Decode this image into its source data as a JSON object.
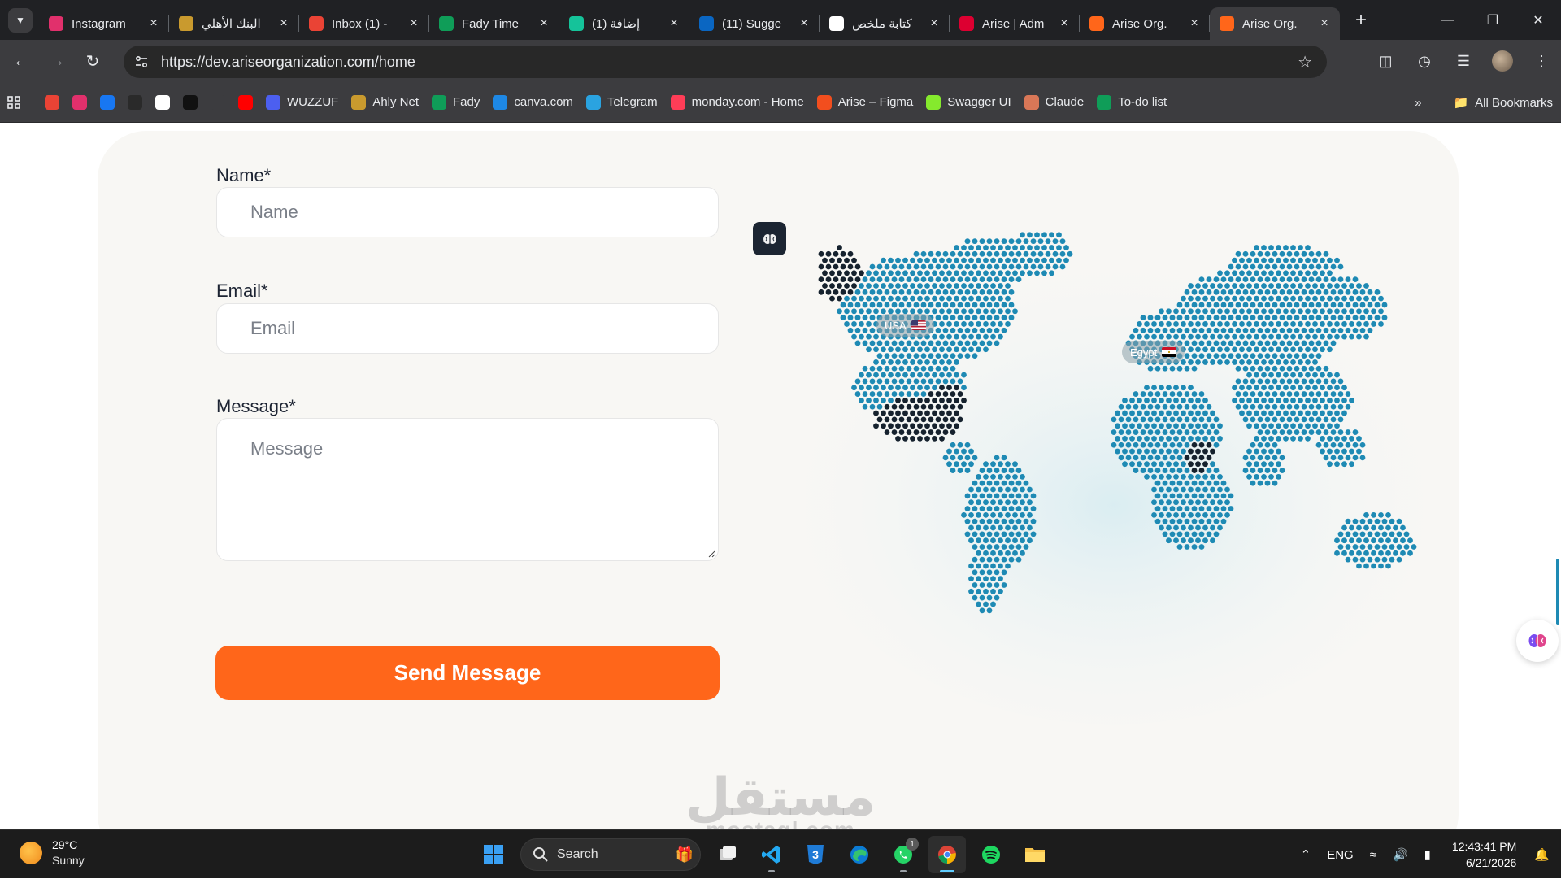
{
  "browser": {
    "tabs": [
      {
        "title": "Instagram",
        "favicon": "instagram-icon",
        "color": "#e1306c"
      },
      {
        "title": "البنك الأهلي",
        "favicon": "ahly-bank-icon",
        "color": "#c99a2e"
      },
      {
        "title": "Inbox (1) -",
        "favicon": "gmail-icon",
        "color": "#ea4335"
      },
      {
        "title": "Fady Time",
        "favicon": "sheets-icon",
        "color": "#0f9d58"
      },
      {
        "title": "(1) إضافة",
        "favicon": "grammarly-icon",
        "color": "#15c39a"
      },
      {
        "title": "(11) Sugge",
        "favicon": "linkedin-icon",
        "color": "#0a66c2"
      },
      {
        "title": "كتابة ملخص",
        "favicon": "chatgpt-icon",
        "color": "#ffffff"
      },
      {
        "title": "Arise | Adm",
        "favicon": "angular-icon",
        "color": "#dd0031"
      },
      {
        "title": "Arise Org.",
        "favicon": "arise-icon",
        "color": "#ff661a"
      },
      {
        "title": "Arise Org.",
        "favicon": "arise-icon",
        "color": "#ff661a"
      }
    ],
    "active_tab_index": 9,
    "url": "https://dev.ariseorganization.com/home",
    "bookmarks": [
      {
        "label": "",
        "icon": "gmail-icon",
        "color": "#ea4335"
      },
      {
        "label": "",
        "icon": "instagram-icon",
        "color": "#e1306c"
      },
      {
        "label": "",
        "icon": "facebook-icon",
        "color": "#1877f2"
      },
      {
        "label": "",
        "icon": "dark-app-icon",
        "color": "#2a2a2a"
      },
      {
        "label": "",
        "icon": "chatgpt-icon",
        "color": "#ffffff"
      },
      {
        "label": "",
        "icon": "365-icon",
        "color": "#111111"
      },
      {
        "label": "",
        "icon": "speedtest-icon",
        "color": "#3c3c3f"
      },
      {
        "label": "",
        "icon": "youtube-icon",
        "color": "#ff0000"
      },
      {
        "label": "WUZZUF",
        "icon": "wuzzuf-icon",
        "color": "#4c5ff0"
      },
      {
        "label": "Ahly Net",
        "icon": "ahly-bank-icon",
        "color": "#c99a2e"
      },
      {
        "label": "Fady",
        "icon": "sheets-icon",
        "color": "#0f9d58"
      },
      {
        "label": "canva.com",
        "icon": "canva-icon",
        "color": "#1e88e5"
      },
      {
        "label": "Telegram",
        "icon": "telegram-icon",
        "color": "#2aa3e0"
      },
      {
        "label": "monday.com - Home",
        "icon": "monday-icon",
        "color": "#ff3d57"
      },
      {
        "label": "Arise – Figma",
        "icon": "figma-icon",
        "color": "#f24e1e"
      },
      {
        "label": "Swagger UI",
        "icon": "swagger-icon",
        "color": "#85ea2d"
      },
      {
        "label": "Claude",
        "icon": "claude-icon",
        "color": "#d97757"
      },
      {
        "label": "To-do list",
        "icon": "sheets-icon",
        "color": "#0f9d58"
      }
    ],
    "all_bookmarks_label": "All Bookmarks"
  },
  "form": {
    "name_label": "Name*",
    "name_placeholder": "Name",
    "email_label": "Email*",
    "email_placeholder": "Email",
    "message_label": "Message*",
    "message_placeholder": "Message",
    "submit_label": "Send Message"
  },
  "map": {
    "pins": [
      {
        "label": "USA",
        "flag": "usa-flag-icon"
      },
      {
        "label": "Egypt",
        "flag": "egypt-flag-icon"
      }
    ],
    "dot_color": "#1e8ab4",
    "highlight_color": "#16222e"
  },
  "watermark": {
    "arabic": "مستقل",
    "latin": "mostaql.com"
  },
  "taskbar": {
    "weather_temp": "29°C",
    "weather_desc": "Sunny",
    "search_label": "Search",
    "whatsapp_badge": "1",
    "language": "ENG",
    "time": "12:43:41 PM",
    "date": "6/21/2026"
  },
  "colors": {
    "accent": "#ff661a",
    "card_bg": "#f8f7f4",
    "text": "#1d2433"
  }
}
